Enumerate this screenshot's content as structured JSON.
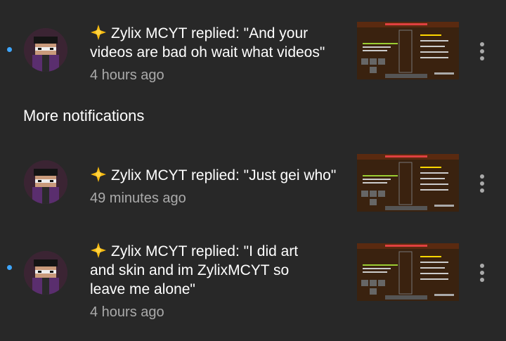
{
  "notifications_top": [
    {
      "author": "Zylix MCYT",
      "message_line1": "Zylix MCYT replied: \"And your",
      "message_line2": "videos are bad oh wait what videos\"",
      "time": "4 hours ago",
      "unread": true
    }
  ],
  "section": {
    "title": "More notifications"
  },
  "notifications_more": [
    {
      "message_line1": "Zylix MCYT replied: \"Just gei who\"",
      "time": "49 minutes ago",
      "unread": false
    },
    {
      "message_line1": "Zylix MCYT replied: \"I did art",
      "message_line2": "and skin and im ZylixMCYT so",
      "message_line3": "leave me alone\"",
      "time": "4 hours ago",
      "unread": true
    }
  ],
  "colors": {
    "background": "#282828",
    "unread_dot": "#3ea6ff",
    "secondary_text": "#aaaaaa"
  },
  "icons": {
    "star": "sparkle-star-icon",
    "menu": "more-vertical-icon"
  }
}
